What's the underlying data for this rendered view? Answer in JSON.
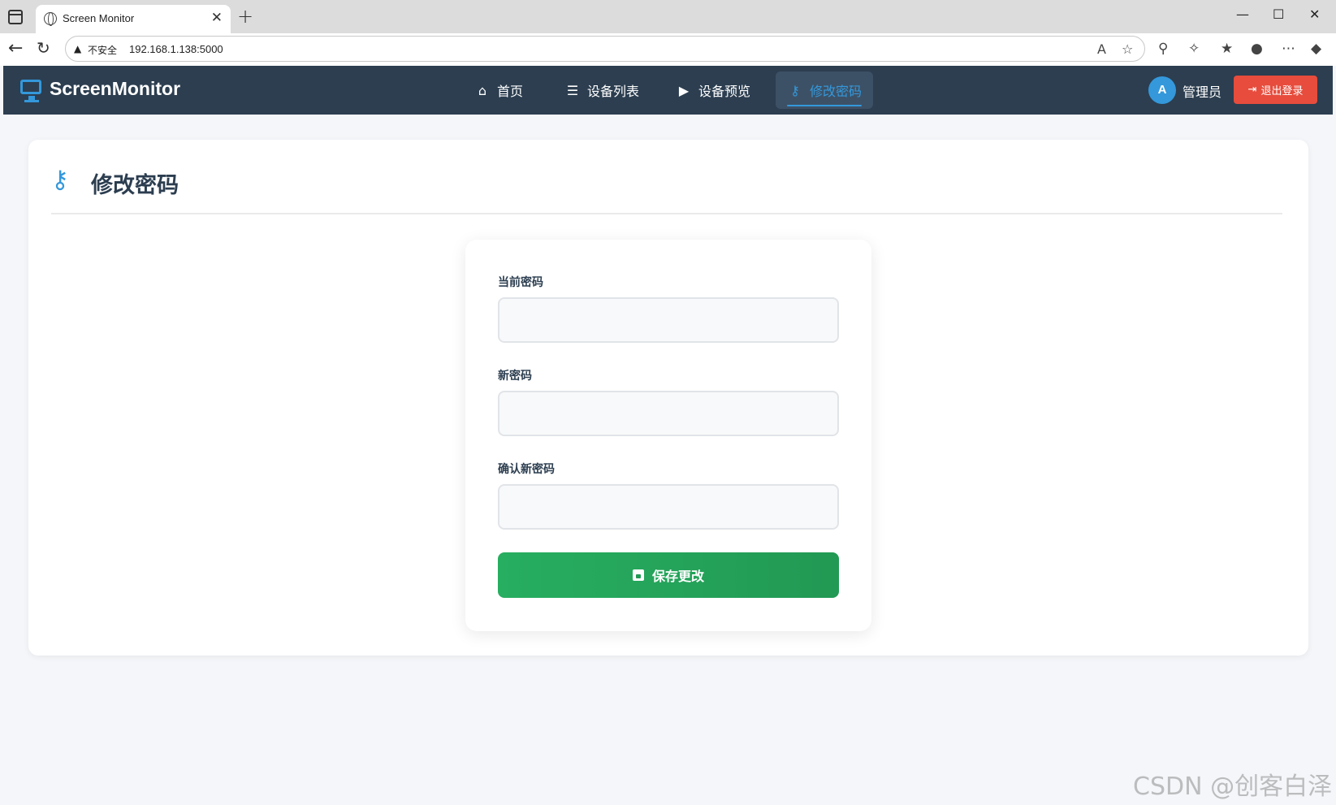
{
  "browser": {
    "tab_title": "Screen Monitor",
    "tab_close": "✕",
    "new_tab": "+",
    "security_label": "不安全",
    "url": "192.168.1.138:5000"
  },
  "app": {
    "brand": "ScreenMonitor",
    "nav": [
      {
        "label": "首页",
        "icon": "home-icon"
      },
      {
        "label": "设备列表",
        "icon": "list-icon"
      },
      {
        "label": "设备预览",
        "icon": "video-camera-icon"
      },
      {
        "label": "修改密码",
        "icon": "key-icon",
        "active": true
      }
    ],
    "user": {
      "avatar_letter": "A",
      "name": "管理员"
    },
    "logout_label": "退出登录"
  },
  "page": {
    "title": "修改密码",
    "form": {
      "current_password_label": "当前密码",
      "new_password_label": "新密码",
      "confirm_password_label": "确认新密码",
      "save_label": "保存更改"
    }
  },
  "watermark": "CSDN @创客白泽",
  "colors": {
    "header_bg": "#2c3e50",
    "accent": "#3498db",
    "danger": "#e74c3c",
    "success": "#27ae60"
  }
}
